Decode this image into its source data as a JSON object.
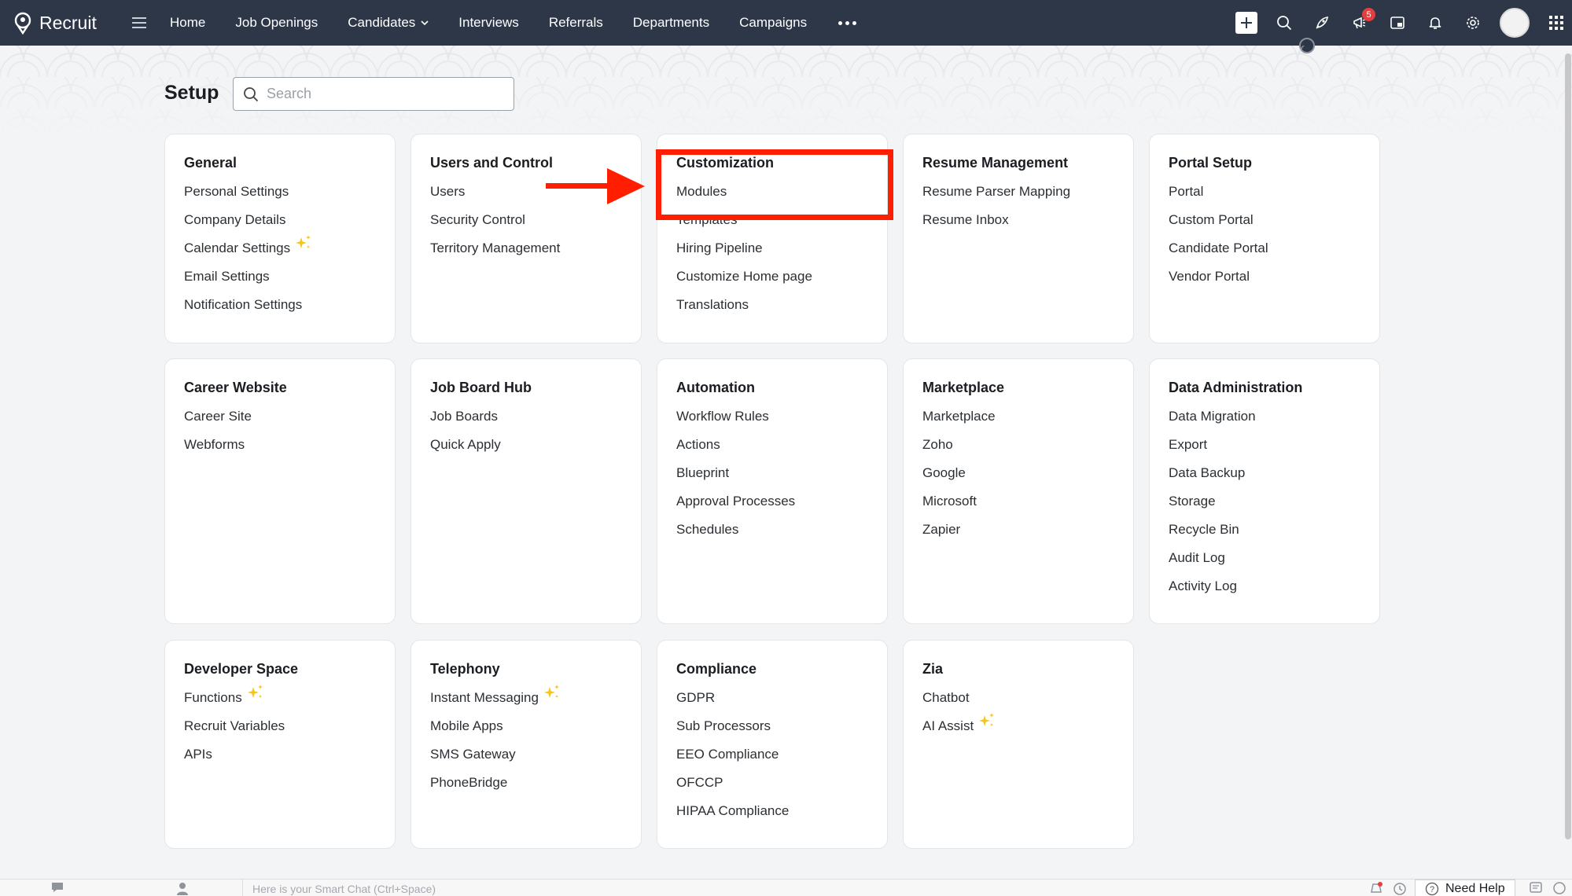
{
  "app": {
    "name": "Recruit"
  },
  "nav": {
    "items": [
      "Home",
      "Job Openings",
      "Candidates",
      "Interviews",
      "Referrals",
      "Departments",
      "Campaigns"
    ],
    "notifications_badge": "5"
  },
  "page": {
    "title": "Setup",
    "search_placeholder": "Search"
  },
  "cards": [
    {
      "title": "General",
      "items": [
        "Personal Settings",
        "Company Details",
        "Calendar Settings",
        "Email Settings",
        "Notification Settings"
      ]
    },
    {
      "title": "Users and Control",
      "items": [
        "Users",
        "Security Control",
        "Territory Management"
      ]
    },
    {
      "title": "Customization",
      "items": [
        "Modules",
        "Templates",
        "Hiring Pipeline",
        "Customize Home page",
        "Translations"
      ]
    },
    {
      "title": "Resume Management",
      "items": [
        "Resume Parser Mapping",
        "Resume Inbox"
      ]
    },
    {
      "title": "Portal Setup",
      "items": [
        "Portal",
        "Custom Portal",
        "Candidate Portal",
        "Vendor Portal"
      ]
    },
    {
      "title": "Career Website",
      "items": [
        "Career Site",
        "Webforms"
      ]
    },
    {
      "title": "Job Board Hub",
      "items": [
        "Job Boards",
        "Quick Apply"
      ]
    },
    {
      "title": "Automation",
      "items": [
        "Workflow Rules",
        "Actions",
        "Blueprint",
        "Approval Processes",
        "Schedules"
      ]
    },
    {
      "title": "Marketplace",
      "items": [
        "Marketplace",
        "Zoho",
        "Google",
        "Microsoft",
        "Zapier"
      ]
    },
    {
      "title": "Data Administration",
      "items": [
        "Data Migration",
        "Export",
        "Data Backup",
        "Storage",
        "Recycle Bin",
        "Audit Log",
        "Activity Log"
      ]
    },
    {
      "title": "Developer Space",
      "items": [
        "Functions",
        "Recruit Variables",
        "APIs"
      ]
    },
    {
      "title": "Telephony",
      "items": [
        "Instant Messaging",
        "Mobile Apps",
        "SMS Gateway",
        "PhoneBridge"
      ]
    },
    {
      "title": "Compliance",
      "items": [
        "GDPR",
        "Sub Processors",
        "EEO Compliance",
        "OFCCP",
        "HIPAA Compliance"
      ]
    },
    {
      "title": "Zia",
      "items": [
        "Chatbot",
        "AI Assist"
      ]
    }
  ],
  "new_badges": [
    "Calendar Settings",
    "Functions",
    "Instant Messaging",
    "AI Assist"
  ],
  "bottom": {
    "smart_chat_placeholder": "Here is your Smart Chat (Ctrl+Space)",
    "need_help": "Need Help"
  },
  "colors": {
    "topbar": "#2d3748",
    "highlight": "#ff1f00",
    "sparkle": "#f5c518"
  }
}
